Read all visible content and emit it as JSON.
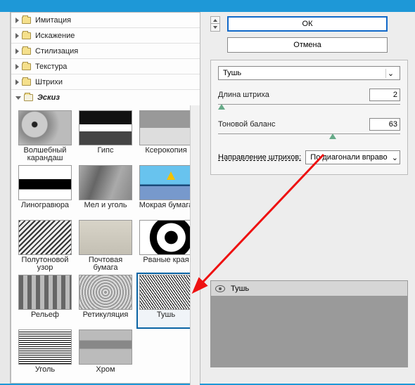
{
  "categories": [
    {
      "label": "Имитация",
      "open": false
    },
    {
      "label": "Искажение",
      "open": false
    },
    {
      "label": "Стилизация",
      "open": false
    },
    {
      "label": "Текстура",
      "open": false
    },
    {
      "label": "Штрихи",
      "open": false
    },
    {
      "label": "Эскиз",
      "open": true
    }
  ],
  "thumbs": [
    {
      "label": "Волшебный карандаш"
    },
    {
      "label": "Гипс"
    },
    {
      "label": "Ксерокопия"
    },
    {
      "label": "Линогравюра"
    },
    {
      "label": "Мел и уголь"
    },
    {
      "label": "Мокрая бумага"
    },
    {
      "label": "Полутоновой узор"
    },
    {
      "label": "Почтовая бумага"
    },
    {
      "label": "Рваные края"
    },
    {
      "label": "Рельеф"
    },
    {
      "label": "Ретикуляция"
    },
    {
      "label": "Тушь"
    },
    {
      "label": "Уголь"
    },
    {
      "label": "Хром"
    }
  ],
  "selected_thumb_index": 11,
  "buttons": {
    "ok": "ОК",
    "cancel": "Отмена"
  },
  "filter_select": "Тушь",
  "params": {
    "stroke": {
      "label": "Длина штриха",
      "value": "2",
      "pos_pct": 2
    },
    "tone": {
      "label": "Тоновой баланс",
      "value": "63",
      "pos_pct": 63
    }
  },
  "direction": {
    "label": "Направление штрихов:",
    "value": "По диагонали вправо"
  },
  "stack": {
    "layer_name": "Тушь"
  }
}
